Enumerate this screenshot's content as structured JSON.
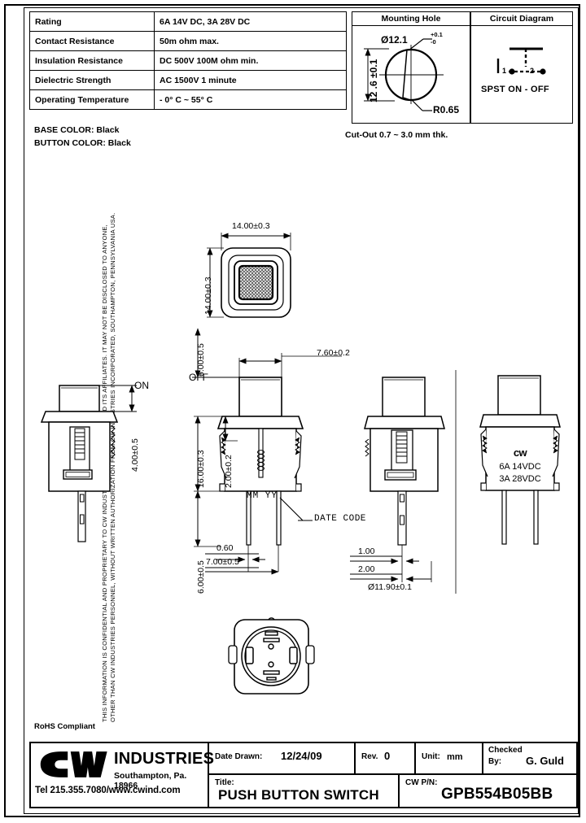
{
  "sheet": {
    "confidential_note_line1": "THIS INFORMATION IS CONFIDENTIAL AND PROPRIETARY TO CW INDUSTRIES INCORPORATED AND ITS AFFILIATES.  IT MAY NOT BE DISCLOSED TO ANYONE,",
    "confidential_note_line2": "OTHER THAN CW INDUSTRIES PERSONNEL, WITHOUT WRITTEN AUTHORIZATION FROM CW INDUSTRIES INCORPORATED, SOUTHAMPTON, PENNSYLVANIA USA.",
    "rohs": "RoHS Compliant"
  },
  "spec_table": {
    "rows": [
      {
        "label": "Rating",
        "value": "6A 14V DC, 3A 28V DC"
      },
      {
        "label": "Contact Resistance",
        "value": "50m ohm max."
      },
      {
        "label": "Insulation Resistance",
        "value": "DC 500V 100M ohm min."
      },
      {
        "label": "Dielectric Strength",
        "value": "AC 1500V 1 minute"
      },
      {
        "label": "Operating Temperature",
        "value": "- 0° C ~ 55° C"
      }
    ]
  },
  "materials": {
    "base_color": "BASE COLOR: Black",
    "button_color": "BUTTON COLOR: Black"
  },
  "mounting_hole": {
    "title": "Mounting Hole",
    "diameter": "Ø12.1",
    "tol_plus": "+0.1",
    "tol_minus": "-0",
    "height": "12 .6 ±0.1",
    "radius": "R0.65",
    "cutout_note": "Cut-Out  0.7 ~ 3.0 mm thk."
  },
  "circuit_diagram": {
    "title": "Circuit Diagram",
    "caption": "SPST  ON - OFF",
    "terminal_1": "1",
    "terminal_2": "2"
  },
  "views": {
    "top_view": {
      "dim_width": "14.00±0.3",
      "dim_height": "14.00±0.3"
    },
    "left_view": {
      "state_label": "ON",
      "dim_travel": "4.00±0.5"
    },
    "front_view": {
      "state_label": "OFF",
      "dim_body_width": "7.60±0.2",
      "dim_overall_height": "16.00±0.3",
      "dim_flange": "2.00±0.2",
      "dim_top_stack": "6.00±0.5",
      "dim_pin_length": "6.00±0.5",
      "dim_pin_thk": "0.60",
      "dim_pin_pitch": "7.00±0.5",
      "date_code_marking": "MM  YY",
      "date_code_label": "DATE CODE"
    },
    "side_view": {
      "dim_pin_width": "1.00",
      "dim_pin_span": "2.00",
      "dim_barrel": "Ø11.90±0.1"
    },
    "rear_view": {
      "brand": "cw",
      "rating_line1": "6A 14VDC",
      "rating_line2": "3A 28VDC"
    }
  },
  "title_block": {
    "company_mark": "cw",
    "company_name": "INDUSTRIES",
    "address": "Southampton, Pa. 18966",
    "contact": "Tel 215.355.7080/www.cwind.com",
    "date_drawn_label": "Date Drawn:",
    "date_drawn_value": "12/24/09",
    "rev_label": "Rev.",
    "rev_value": "0",
    "unit_label": "Unit:",
    "unit_value": "mm",
    "checked_by_label": "Checked\nBy:",
    "checked_by_label_1": "Checked",
    "checked_by_label_2": "By:",
    "checked_by_value": "G. Guld",
    "title_label": "Title:",
    "title_value": "PUSH BUTTON SWITCH",
    "pn_label": "CW P/N:",
    "pn_value": "GPB554B05BB"
  }
}
